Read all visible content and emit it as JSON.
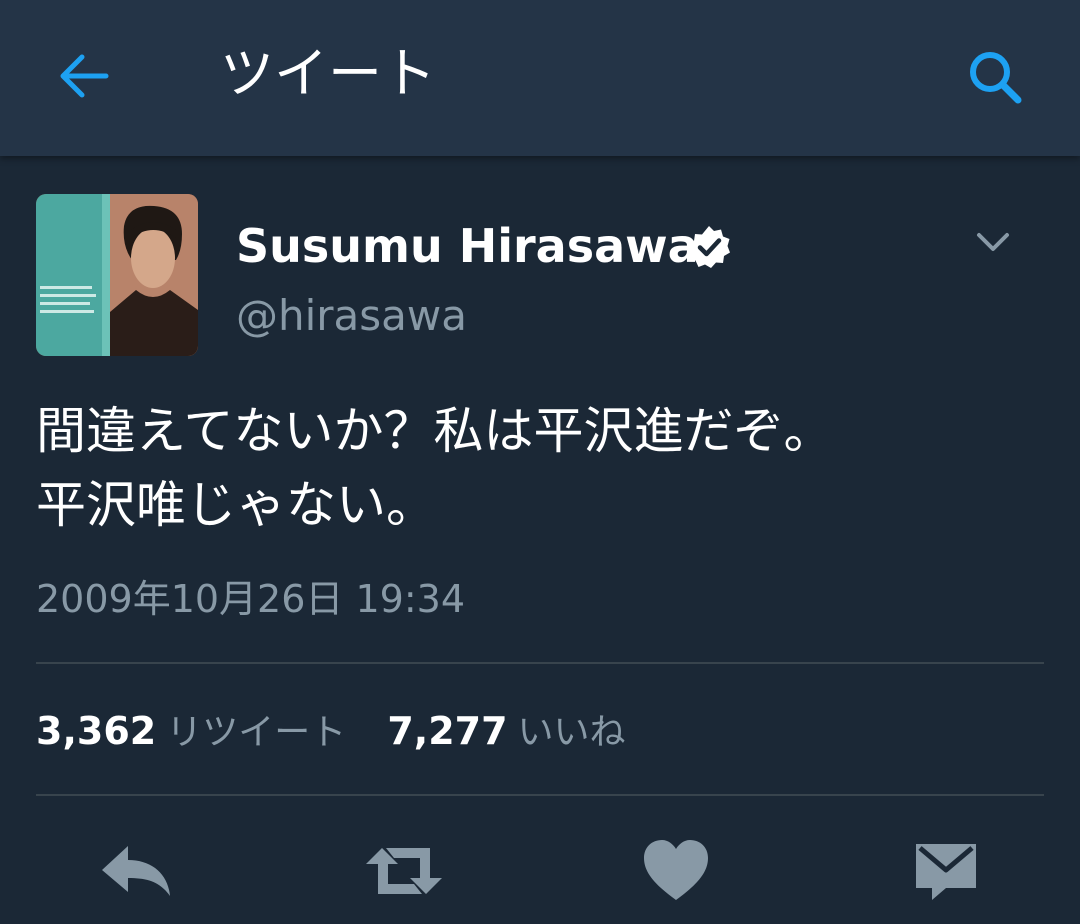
{
  "header": {
    "title": "ツイート",
    "back_icon": "arrow-left-icon",
    "search_icon": "search-icon",
    "accent_color": "#1da1f2"
  },
  "tweet": {
    "display_name": "Susumu Hirasawa",
    "verified": true,
    "handle": "@hirasawa",
    "text_lines": [
      "間違えてないか？私は平沢進だぞ。",
      "平沢唯じゃない。"
    ],
    "timestamp": "2009年10月26日 19:34",
    "retweet_count": "3,362",
    "retweet_label": "リツイート",
    "like_count": "7,277",
    "like_label": "いいね"
  },
  "actions": [
    {
      "name": "reply",
      "icon": "reply-icon"
    },
    {
      "name": "retweet",
      "icon": "retweet-icon"
    },
    {
      "name": "like",
      "icon": "heart-icon"
    },
    {
      "name": "direct-message",
      "icon": "envelope-icon"
    }
  ],
  "colors": {
    "background": "#1b2836",
    "header_background": "#243447",
    "secondary_text": "#8899a6",
    "divider": "#38444d",
    "action_icon": "#8899a6"
  }
}
